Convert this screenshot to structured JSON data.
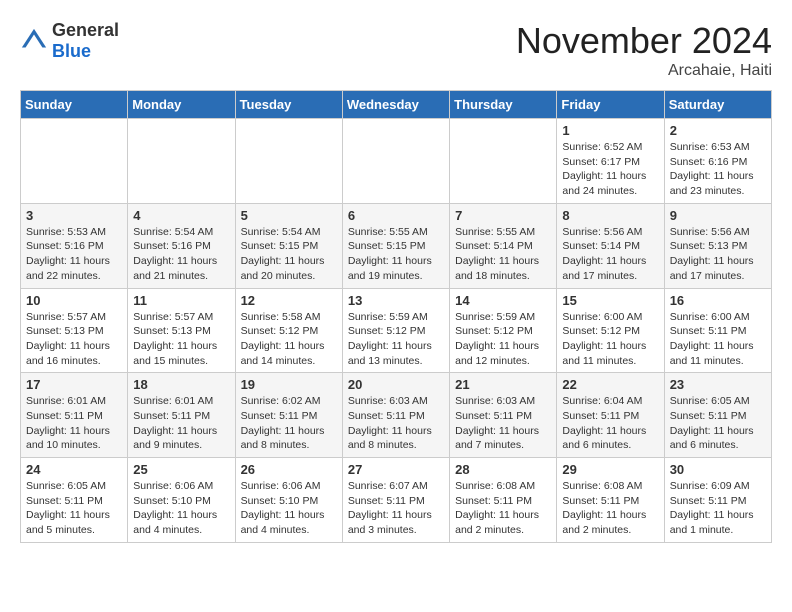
{
  "header": {
    "logo_general": "General",
    "logo_blue": "Blue",
    "month": "November 2024",
    "location": "Arcahaie, Haiti"
  },
  "weekdays": [
    "Sunday",
    "Monday",
    "Tuesday",
    "Wednesday",
    "Thursday",
    "Friday",
    "Saturday"
  ],
  "rows": [
    [
      {
        "day": "",
        "info": ""
      },
      {
        "day": "",
        "info": ""
      },
      {
        "day": "",
        "info": ""
      },
      {
        "day": "",
        "info": ""
      },
      {
        "day": "",
        "info": ""
      },
      {
        "day": "1",
        "info": "Sunrise: 6:52 AM\nSunset: 6:17 PM\nDaylight: 11 hours\nand 24 minutes."
      },
      {
        "day": "2",
        "info": "Sunrise: 6:53 AM\nSunset: 6:16 PM\nDaylight: 11 hours\nand 23 minutes."
      }
    ],
    [
      {
        "day": "3",
        "info": "Sunrise: 5:53 AM\nSunset: 5:16 PM\nDaylight: 11 hours\nand 22 minutes."
      },
      {
        "day": "4",
        "info": "Sunrise: 5:54 AM\nSunset: 5:16 PM\nDaylight: 11 hours\nand 21 minutes."
      },
      {
        "day": "5",
        "info": "Sunrise: 5:54 AM\nSunset: 5:15 PM\nDaylight: 11 hours\nand 20 minutes."
      },
      {
        "day": "6",
        "info": "Sunrise: 5:55 AM\nSunset: 5:15 PM\nDaylight: 11 hours\nand 19 minutes."
      },
      {
        "day": "7",
        "info": "Sunrise: 5:55 AM\nSunset: 5:14 PM\nDaylight: 11 hours\nand 18 minutes."
      },
      {
        "day": "8",
        "info": "Sunrise: 5:56 AM\nSunset: 5:14 PM\nDaylight: 11 hours\nand 17 minutes."
      },
      {
        "day": "9",
        "info": "Sunrise: 5:56 AM\nSunset: 5:13 PM\nDaylight: 11 hours\nand 17 minutes."
      }
    ],
    [
      {
        "day": "10",
        "info": "Sunrise: 5:57 AM\nSunset: 5:13 PM\nDaylight: 11 hours\nand 16 minutes."
      },
      {
        "day": "11",
        "info": "Sunrise: 5:57 AM\nSunset: 5:13 PM\nDaylight: 11 hours\nand 15 minutes."
      },
      {
        "day": "12",
        "info": "Sunrise: 5:58 AM\nSunset: 5:12 PM\nDaylight: 11 hours\nand 14 minutes."
      },
      {
        "day": "13",
        "info": "Sunrise: 5:59 AM\nSunset: 5:12 PM\nDaylight: 11 hours\nand 13 minutes."
      },
      {
        "day": "14",
        "info": "Sunrise: 5:59 AM\nSunset: 5:12 PM\nDaylight: 11 hours\nand 12 minutes."
      },
      {
        "day": "15",
        "info": "Sunrise: 6:00 AM\nSunset: 5:12 PM\nDaylight: 11 hours\nand 11 minutes."
      },
      {
        "day": "16",
        "info": "Sunrise: 6:00 AM\nSunset: 5:11 PM\nDaylight: 11 hours\nand 11 minutes."
      }
    ],
    [
      {
        "day": "17",
        "info": "Sunrise: 6:01 AM\nSunset: 5:11 PM\nDaylight: 11 hours\nand 10 minutes."
      },
      {
        "day": "18",
        "info": "Sunrise: 6:01 AM\nSunset: 5:11 PM\nDaylight: 11 hours\nand 9 minutes."
      },
      {
        "day": "19",
        "info": "Sunrise: 6:02 AM\nSunset: 5:11 PM\nDaylight: 11 hours\nand 8 minutes."
      },
      {
        "day": "20",
        "info": "Sunrise: 6:03 AM\nSunset: 5:11 PM\nDaylight: 11 hours\nand 8 minutes."
      },
      {
        "day": "21",
        "info": "Sunrise: 6:03 AM\nSunset: 5:11 PM\nDaylight: 11 hours\nand 7 minutes."
      },
      {
        "day": "22",
        "info": "Sunrise: 6:04 AM\nSunset: 5:11 PM\nDaylight: 11 hours\nand 6 minutes."
      },
      {
        "day": "23",
        "info": "Sunrise: 6:05 AM\nSunset: 5:11 PM\nDaylight: 11 hours\nand 6 minutes."
      }
    ],
    [
      {
        "day": "24",
        "info": "Sunrise: 6:05 AM\nSunset: 5:11 PM\nDaylight: 11 hours\nand 5 minutes."
      },
      {
        "day": "25",
        "info": "Sunrise: 6:06 AM\nSunset: 5:10 PM\nDaylight: 11 hours\nand 4 minutes."
      },
      {
        "day": "26",
        "info": "Sunrise: 6:06 AM\nSunset: 5:10 PM\nDaylight: 11 hours\nand 4 minutes."
      },
      {
        "day": "27",
        "info": "Sunrise: 6:07 AM\nSunset: 5:11 PM\nDaylight: 11 hours\nand 3 minutes."
      },
      {
        "day": "28",
        "info": "Sunrise: 6:08 AM\nSunset: 5:11 PM\nDaylight: 11 hours\nand 2 minutes."
      },
      {
        "day": "29",
        "info": "Sunrise: 6:08 AM\nSunset: 5:11 PM\nDaylight: 11 hours\nand 2 minutes."
      },
      {
        "day": "30",
        "info": "Sunrise: 6:09 AM\nSunset: 5:11 PM\nDaylight: 11 hours\nand 1 minute."
      }
    ]
  ]
}
